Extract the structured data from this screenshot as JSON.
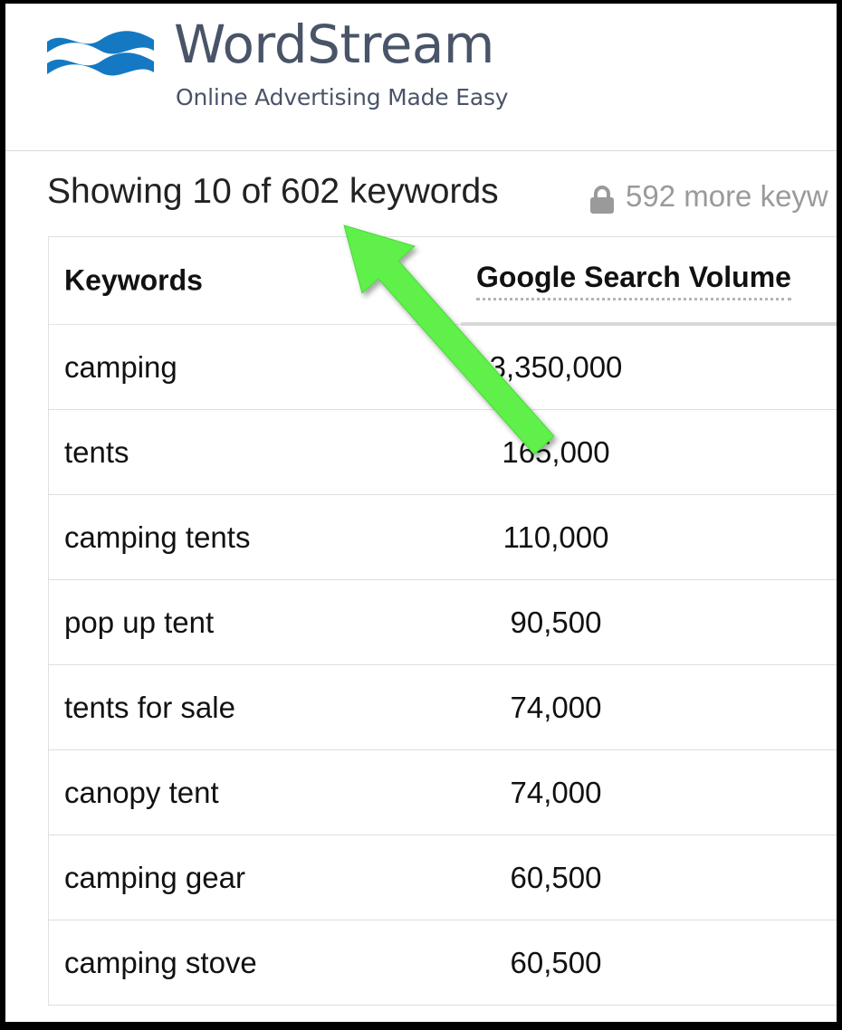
{
  "brand": {
    "name": "WordStream",
    "tagline": "Online Advertising Made Easy",
    "logo_color": "#1479c2",
    "text_color": "#4a5468"
  },
  "summary": {
    "showing_text": "Showing 10 of 602 keywords",
    "more_text": "592 more keyw",
    "lock_icon": "lock-icon"
  },
  "table": {
    "columns": [
      "Keywords",
      "Google Search Volume"
    ],
    "rows": [
      {
        "keyword": "camping",
        "volume": "3,350,000"
      },
      {
        "keyword": "tents",
        "volume": "165,000"
      },
      {
        "keyword": "camping tents",
        "volume": "110,000"
      },
      {
        "keyword": "pop up tent",
        "volume": "90,500"
      },
      {
        "keyword": "tents for sale",
        "volume": "74,000"
      },
      {
        "keyword": "canopy tent",
        "volume": "74,000"
      },
      {
        "keyword": "camping gear",
        "volume": "60,500"
      },
      {
        "keyword": "camping stove",
        "volume": "60,500"
      }
    ]
  },
  "annotation": {
    "arrow_color": "#5ef04a"
  }
}
